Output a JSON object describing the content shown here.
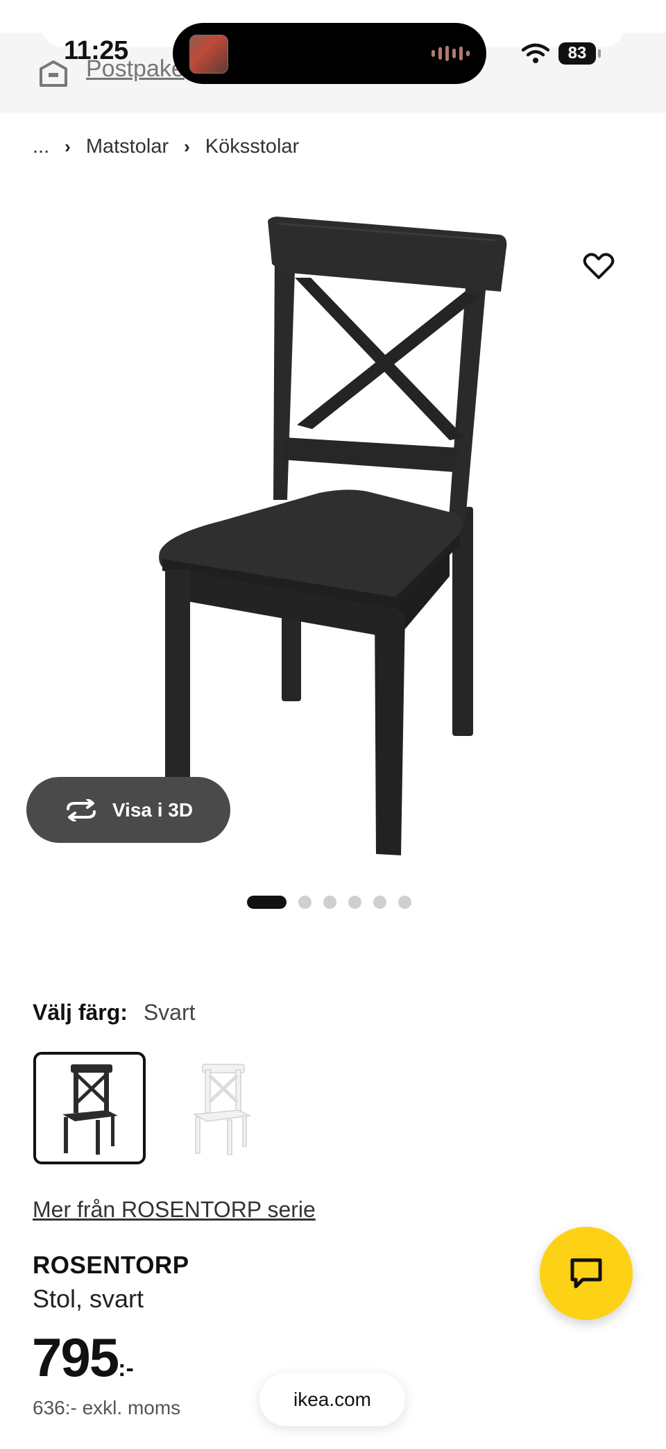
{
  "status_bar": {
    "time": "11:25",
    "battery": "83"
  },
  "top_bar": {
    "package_label": "Postpake"
  },
  "breadcrumb": {
    "ellipsis": "...",
    "items": [
      "Matstolar",
      "Köksstolar"
    ]
  },
  "gallery": {
    "view_3d_label": "Visa i 3D",
    "slides": 6,
    "active_index": 0
  },
  "color_picker": {
    "label": "Välj färg:",
    "selected": "Svart",
    "options": [
      {
        "name": "black-chair",
        "color": "#2b2b2b"
      },
      {
        "name": "white-chair",
        "color": "#f2f2f2"
      }
    ]
  },
  "product": {
    "series_link": "Mer från ROSENTORP serie",
    "name": "ROSENTORP",
    "description": "Stol, svart",
    "price": "795",
    "price_suffix": ":-",
    "price_ex_vat": "636:- exkl. moms"
  },
  "browser": {
    "url": "ikea.com"
  },
  "colors": {
    "accent_yellow": "#fcd116",
    "button_dark": "#4a4a4a"
  }
}
